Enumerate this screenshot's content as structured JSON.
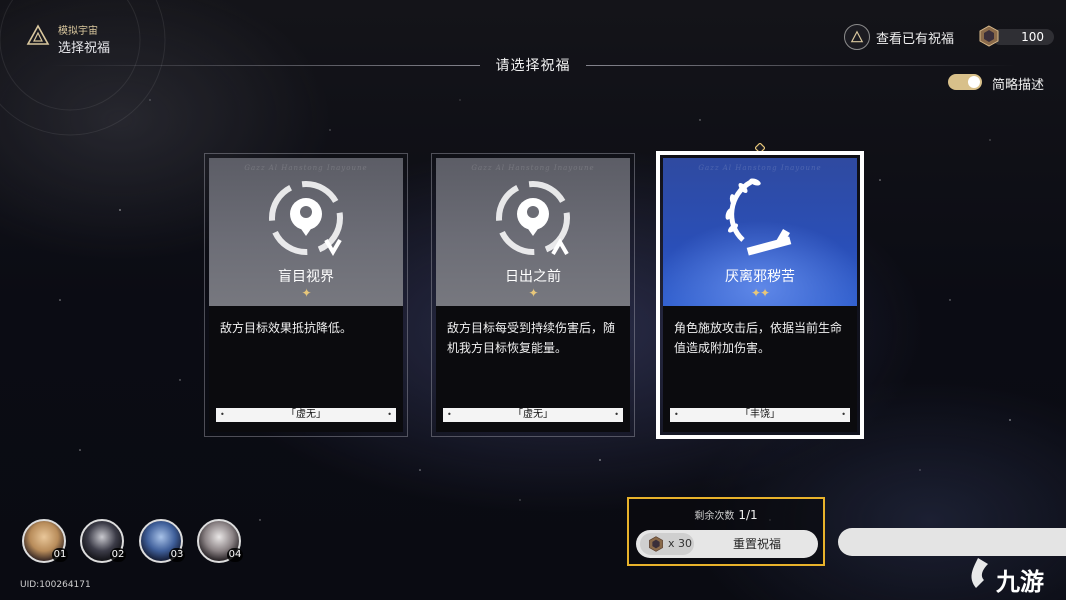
{
  "header": {
    "mode": "模拟宇宙",
    "title": "选择祝福",
    "view_blessings": "查看已有祝福",
    "currency_value": "100",
    "prompt": "请选择祝福",
    "toggle_label": "简略描述",
    "toggle_on": true
  },
  "cards": [
    {
      "name": "盲目视界",
      "stars": "✦",
      "description": "敌方目标效果抵抗降低。",
      "path": "「虚无」",
      "watermark": "Gazz Al Hanstong Inayoune",
      "selected": false
    },
    {
      "name": "日出之前",
      "stars": "✦",
      "description": "敌方目标每受到持续伤害后，随机我方目标恢复能量。",
      "path": "「虚无」",
      "watermark": "Gazz Al Hanstong Inayoune",
      "selected": false
    },
    {
      "name": "厌离邪秽苦",
      "stars": "✦✦",
      "description": "角色施放攻击后，依据当前生命值造成附加伤害。",
      "path": "「丰饶」",
      "watermark": "Gazz Al Hanstong Inayoune",
      "selected": true
    }
  ],
  "party": [
    "01",
    "02",
    "03",
    "04"
  ],
  "uid": "UID:100264171",
  "reset": {
    "remaining_label": "剩余次数",
    "remaining_value": "1/1",
    "cost": "x 30",
    "button_label": "重置祝福"
  },
  "watermark_text": "九游",
  "colors": {
    "accent_gold": "#e8b22b",
    "selected_blue": "#2f55c0"
  }
}
